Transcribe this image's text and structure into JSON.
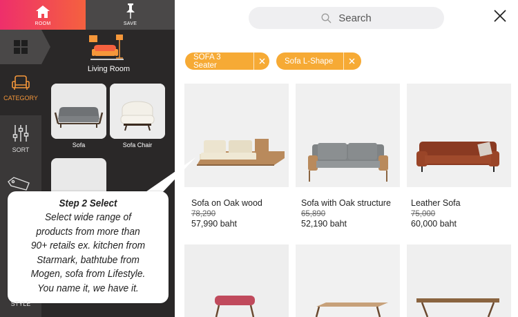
{
  "tabs": {
    "room_label": "ROOM",
    "save_label": "SAVE"
  },
  "rail": [
    {
      "label": "CATEGORY",
      "icon": "armchair-icon"
    },
    {
      "label": "SORT",
      "icon": "sliders-icon"
    },
    {
      "label": "STYLE",
      "icon": "tag-icon"
    }
  ],
  "room": {
    "label": "Living Room",
    "icon": "living-room-icon"
  },
  "categories": [
    {
      "label": "Sofa"
    },
    {
      "label": "Sofa Chair"
    }
  ],
  "callout": {
    "title": "Step 2 Select",
    "lines": [
      "Select wide range of",
      "products from more than",
      "90+ retails ex. kitchen from",
      "Starmark, bathtube from",
      "Mogen, sofa from Lifestyle.",
      "You name it, we have it."
    ]
  },
  "search": {
    "placeholder": "Search"
  },
  "filters": [
    {
      "label": "SOFA 3 Seater"
    },
    {
      "label": "Sofa L-Shape"
    }
  ],
  "products": [
    {
      "name": "Sofa on Oak wood",
      "old_price": "78,290",
      "price": "57,990 baht"
    },
    {
      "name": "Sofa with Oak structure",
      "old_price": "65,890",
      "price": "52,190 baht"
    },
    {
      "name": "Leather Sofa",
      "old_price": "75,000",
      "price": "60,000 baht"
    }
  ],
  "colors": {
    "accent_orange": "#f6aa35",
    "room_gradient_start": "#ee2f6b",
    "room_gradient_end": "#f5613f",
    "panel_dark": "#2a2828"
  }
}
